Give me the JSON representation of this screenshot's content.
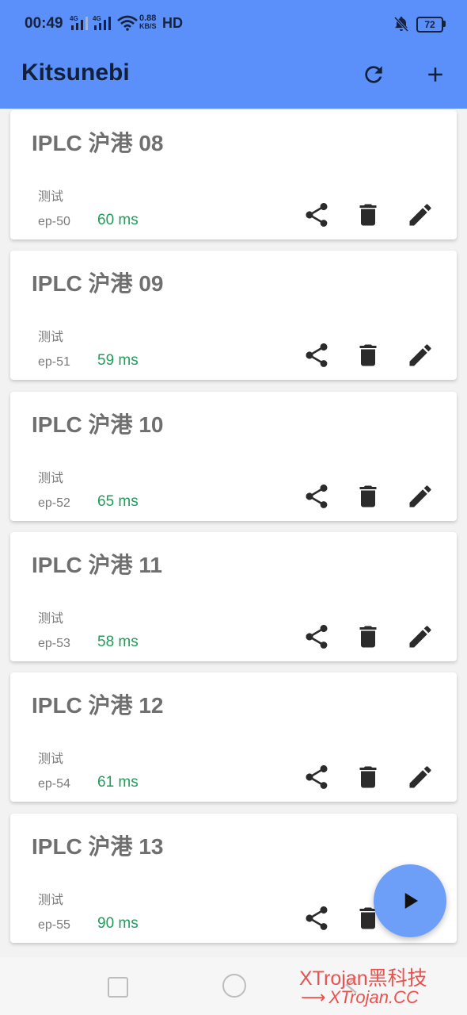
{
  "status_bar": {
    "time": "00:49",
    "sim1": "4G",
    "sim2": "4G",
    "net_speed_value": "0.88",
    "net_speed_unit": "KB/S",
    "hd": "HD",
    "battery": "72"
  },
  "app_bar": {
    "title": "Kitsunebi",
    "refresh_icon": "refresh-icon",
    "add_icon": "plus-icon"
  },
  "servers": [
    {
      "name": "IPLC 沪港 08",
      "group": "测试",
      "endpoint": "ep-50",
      "latency": "60 ms"
    },
    {
      "name": "IPLC 沪港 09",
      "group": "测试",
      "endpoint": "ep-51",
      "latency": "59 ms"
    },
    {
      "name": "IPLC 沪港 10",
      "group": "测试",
      "endpoint": "ep-52",
      "latency": "65 ms"
    },
    {
      "name": "IPLC 沪港 11",
      "group": "测试",
      "endpoint": "ep-53",
      "latency": "58 ms"
    },
    {
      "name": "IPLC 沪港 12",
      "group": "测试",
      "endpoint": "ep-54",
      "latency": "61 ms"
    },
    {
      "name": "IPLC 沪港 13",
      "group": "测试",
      "endpoint": "ep-55",
      "latency": "90 ms"
    }
  ],
  "card_actions": [
    "share-icon",
    "delete-icon",
    "edit-icon"
  ],
  "fab": {
    "icon": "play-icon"
  },
  "watermark": {
    "line1": "XTrojan黑科技",
    "arrow": "⟶",
    "line2": "XTrojan.CC"
  },
  "colors": {
    "app_bar": "#5b8ff9",
    "latency": "#1e9e5a",
    "fab": "#6d9ff9",
    "watermark": "#e8524f"
  }
}
